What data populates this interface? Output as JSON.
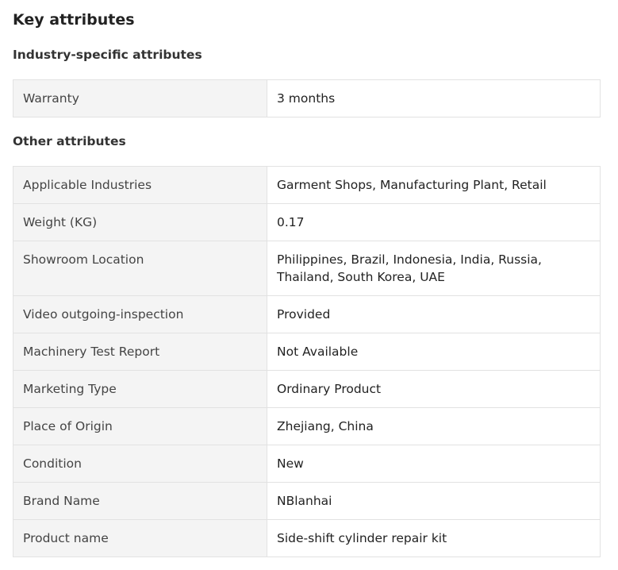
{
  "heading": "Key attributes",
  "industry": {
    "title": "Industry-specific attributes",
    "rows": [
      {
        "key": "Warranty",
        "value": "3 months"
      }
    ]
  },
  "other": {
    "title": "Other attributes",
    "rows": [
      {
        "key": "Applicable Industries",
        "value": "Garment Shops, Manufacturing Plant, Retail"
      },
      {
        "key": "Weight (KG)",
        "value": "0.17"
      },
      {
        "key": "Showroom Location",
        "value": "Philippines, Brazil, Indonesia, India, Russia, Thailand, South Korea, UAE"
      },
      {
        "key": "Video outgoing-inspection",
        "value": "Provided"
      },
      {
        "key": "Machinery Test Report",
        "value": "Not Available"
      },
      {
        "key": "Marketing Type",
        "value": "Ordinary Product"
      },
      {
        "key": "Place of Origin",
        "value": "Zhejiang, China"
      },
      {
        "key": "Condition",
        "value": "New"
      },
      {
        "key": "Brand Name",
        "value": "NBlanhai"
      },
      {
        "key": "Product name",
        "value": "Side-shift cylinder repair kit"
      }
    ]
  }
}
